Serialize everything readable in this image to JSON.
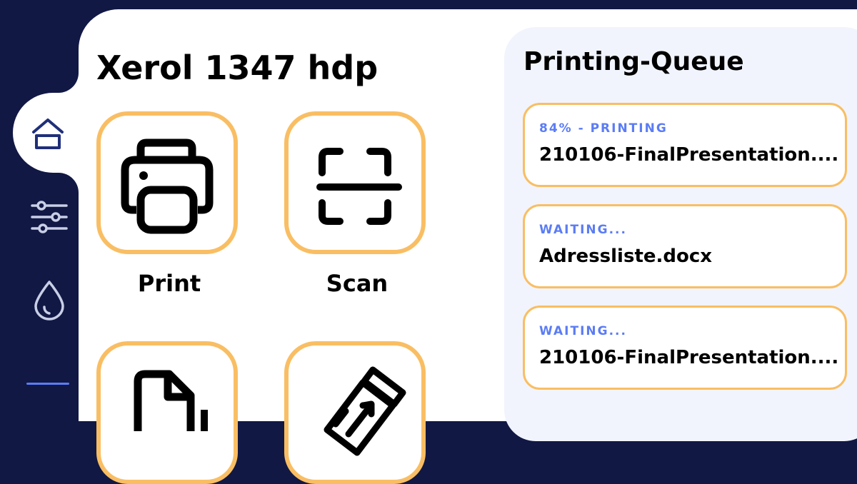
{
  "device": {
    "title": "Xerol 1347 hdp"
  },
  "sidebar": {
    "items": [
      {
        "name": "home",
        "icon": "home-icon",
        "active": true
      },
      {
        "name": "settings",
        "icon": "sliders-icon",
        "active": false
      },
      {
        "name": "ink",
        "icon": "ink-drop-icon",
        "active": false
      }
    ]
  },
  "actions": [
    {
      "label": "Print",
      "icon": "printer-icon"
    },
    {
      "label": "Scan",
      "icon": "scan-icon"
    },
    {
      "label": "",
      "icon": "document-icon"
    },
    {
      "label": "",
      "icon": "usb-drive-icon"
    }
  ],
  "queue": {
    "title": "Printing-Queue",
    "jobs": [
      {
        "status": "84% - PRINTING",
        "name": "210106-FinalPresentation...."
      },
      {
        "status": "WAITING...",
        "name": "Adressliste.docx"
      },
      {
        "status": "WAITING...",
        "name": "210106-FinalPresentation...."
      }
    ]
  },
  "colors": {
    "sidebar_bg": "#111844",
    "accent_orange": "#f9be63",
    "accent_blue": "#5b7cf5",
    "queue_bg": "#f1f4fd"
  }
}
